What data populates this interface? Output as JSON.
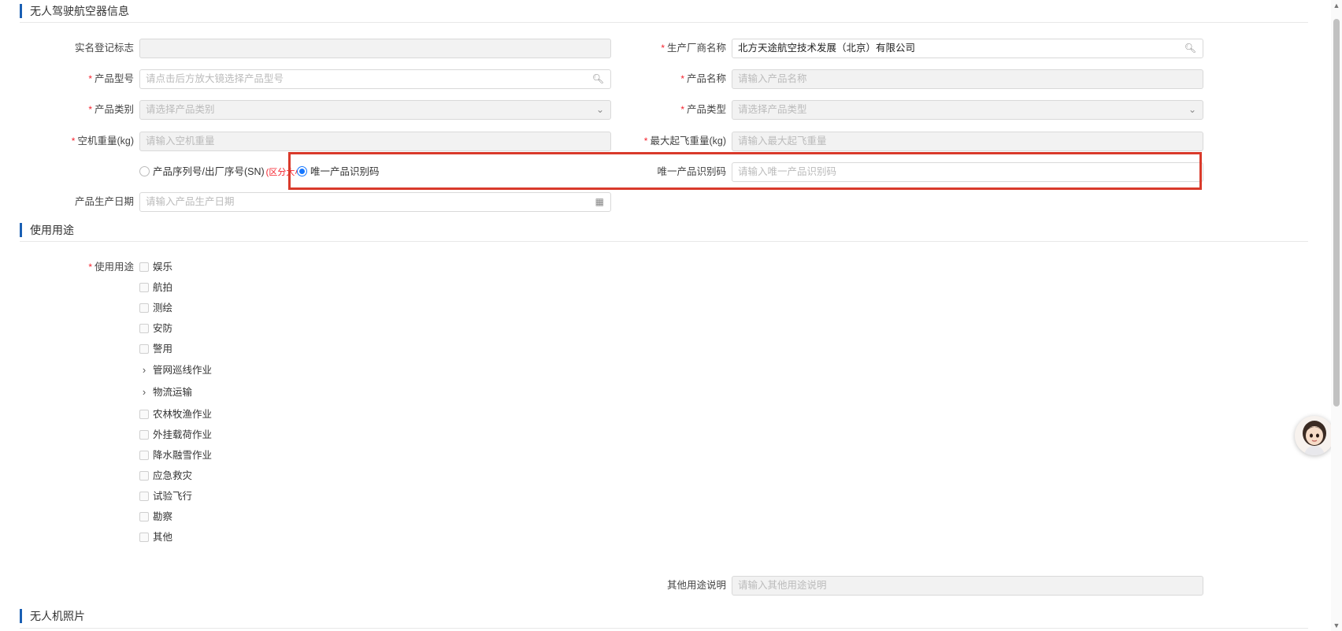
{
  "sections": {
    "uav_info": "无人驾驶航空器信息",
    "usage": "使用用途",
    "photos": "无人机照片"
  },
  "fields": {
    "real_name_mark": {
      "label": "实名登记标志",
      "value": ""
    },
    "manufacturer": {
      "label": "生产厂商名称",
      "value": "北方天途航空技术发展（北京）有限公司"
    },
    "product_model": {
      "label": "产品型号",
      "placeholder": "请点击后方放大镜选择产品型号"
    },
    "product_name": {
      "label": "产品名称",
      "placeholder": "请输入产品名称"
    },
    "product_category": {
      "label": "产品类别",
      "placeholder": "请选择产品类别"
    },
    "product_type": {
      "label": "产品类型",
      "placeholder": "请选择产品类型"
    },
    "empty_weight": {
      "label": "空机重量(kg)",
      "placeholder": "请输入空机重量"
    },
    "max_takeoff_weight": {
      "label": "最大起飞重量(kg)",
      "placeholder": "请输入最大起飞重量"
    },
    "serial_radio": {
      "label": "产品序列号/出厂序号(SN)",
      "note": "(区分大小写"
    },
    "unique_code_radio": {
      "label": "唯一产品识别码"
    },
    "unique_code": {
      "label": "唯一产品识别码",
      "placeholder": "请输入唯一产品识别码"
    },
    "production_date": {
      "label": "产品生产日期",
      "placeholder": "请输入产品生产日期"
    },
    "usage": {
      "label": "使用用途"
    },
    "other_usage": {
      "label": "其他用途说明",
      "placeholder": "请输入其他用途说明"
    }
  },
  "usage_options": [
    "娱乐",
    "航拍",
    "测绘",
    "安防",
    "警用",
    "管网巡线作业",
    "物流运输",
    "农林牧渔作业",
    "外挂载荷作业",
    "降水融雪作业",
    "应急救灾",
    "试验飞行",
    "勘察",
    "其他"
  ],
  "colors": {
    "accent": "#1a5fb4",
    "required": "#f5222d",
    "highlight": "#d93a2b",
    "radio": "#1677ff"
  }
}
